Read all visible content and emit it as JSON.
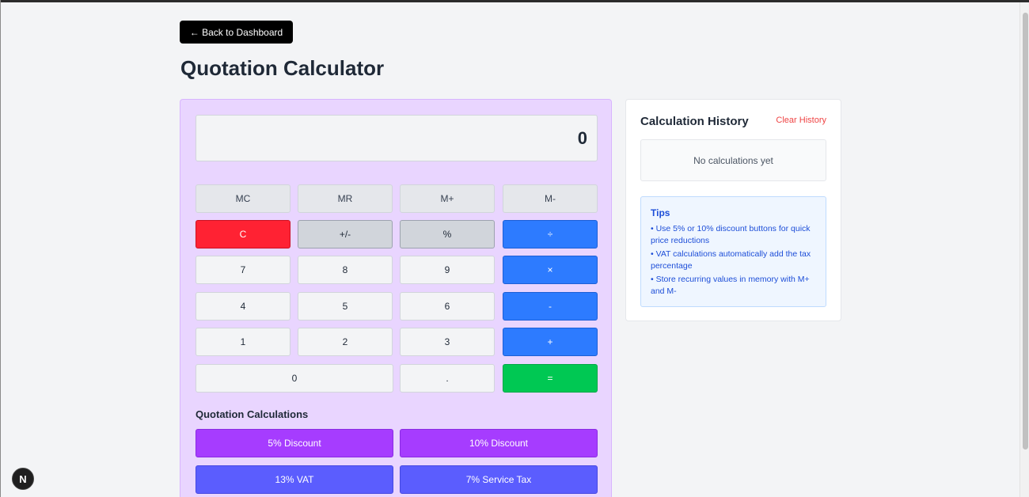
{
  "back_button": {
    "label": "← Back to Dashboard"
  },
  "page": {
    "title": "Quotation Calculator"
  },
  "calculator": {
    "display_value": "0",
    "memory_keys": [
      "MC",
      "MR",
      "M+",
      "M-"
    ],
    "function_keys": {
      "clear": "C",
      "sign": "+/-",
      "percent": "%"
    },
    "operators": {
      "divide": "÷",
      "multiply": "×",
      "subtract": "-",
      "add": "+",
      "equals": "="
    },
    "digits": {
      "seven": "7",
      "eight": "8",
      "nine": "9",
      "four": "4",
      "five": "5",
      "six": "6",
      "one": "1",
      "two": "2",
      "three": "3",
      "zero": "0",
      "decimal": "."
    },
    "quotation": {
      "title": "Quotation Calculations",
      "buttons": [
        "5% Discount",
        "10% Discount",
        "13% VAT",
        "7% Service Tax"
      ]
    }
  },
  "history": {
    "title": "Calculation History",
    "clear_label": "Clear History",
    "empty_text": "No calculations yet",
    "tips": {
      "title": "Tips",
      "items": [
        "• Use 5% or 10% discount buttons for quick price reductions",
        "• VAT calculations automatically add the tax percentage",
        "• Store recurring values in memory with M+ and M-"
      ]
    }
  },
  "badge": {
    "letter": "N"
  },
  "colors": {
    "calculator_bg": "#e9d5ff",
    "clear": "#ff2233",
    "operator": "#2d7bff",
    "equals": "#00c853",
    "discount": "#a63cff",
    "tax": "#5b5dfe"
  }
}
